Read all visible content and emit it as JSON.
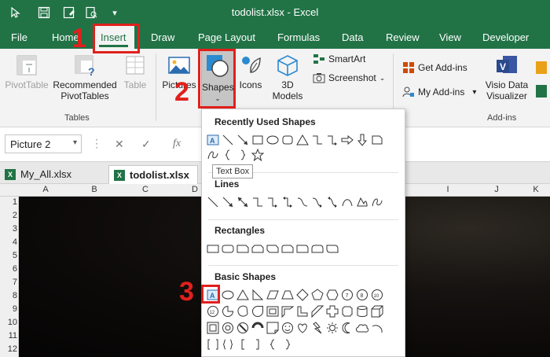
{
  "window": {
    "title": "todolist.xlsx  -  Excel"
  },
  "quick_access": [
    {
      "icon": "cursor-icon"
    },
    {
      "icon": "save-icon"
    },
    {
      "icon": "save-as-icon"
    },
    {
      "icon": "print-preview-icon"
    },
    {
      "icon": "customize-toolbar-icon",
      "glyph": "▾"
    }
  ],
  "tabs": [
    "File",
    "Home",
    "Insert",
    "Draw",
    "Page Layout",
    "Formulas",
    "Data",
    "Review",
    "View",
    "Developer"
  ],
  "active_tab": "Insert",
  "ribbon": {
    "tables": {
      "pivot_table": "PivotTable",
      "recommended": "Recommended PivotTables",
      "recommended_line1": "Recommended",
      "recommended_line2": "PivotTables",
      "table": "Table",
      "group_label": "Tables"
    },
    "illustrations": {
      "pictures": "Pictures",
      "shapes": "Shapes",
      "icons": "Icons",
      "models_line1": "3D",
      "models_line2": "Models",
      "smartart": "SmartArt",
      "screenshot": "Screenshot"
    },
    "addins": {
      "get_addins": "Get Add-ins",
      "my_addins": "My Add-ins",
      "visio_line1": "Visio Data",
      "visio_line2": "Visualizer",
      "group_label": "Add-ins"
    }
  },
  "formula_bar": {
    "name_box": "Picture 2",
    "fx": "fx"
  },
  "sheet_tabs": [
    {
      "label": "My_All.xlsx",
      "active": false
    },
    {
      "label": "todolist.xlsx",
      "active": true
    }
  ],
  "columns": [
    "A",
    "B",
    "C",
    "D",
    "I",
    "J",
    "K"
  ],
  "rows": [
    "1",
    "2",
    "3",
    "4",
    "5",
    "6",
    "7",
    "8",
    "9",
    "10",
    "11",
    "12"
  ],
  "shapes_menu": {
    "recently_used": "Recently Used Shapes",
    "tooltip": "Text Box",
    "lines": "Lines",
    "rectangles": "Rectangles",
    "basic_shapes": "Basic Shapes"
  },
  "annotations": [
    "1",
    "2",
    "3"
  ],
  "colors": {
    "excel_green": "#217346",
    "annotation_red": "#e0201c"
  }
}
